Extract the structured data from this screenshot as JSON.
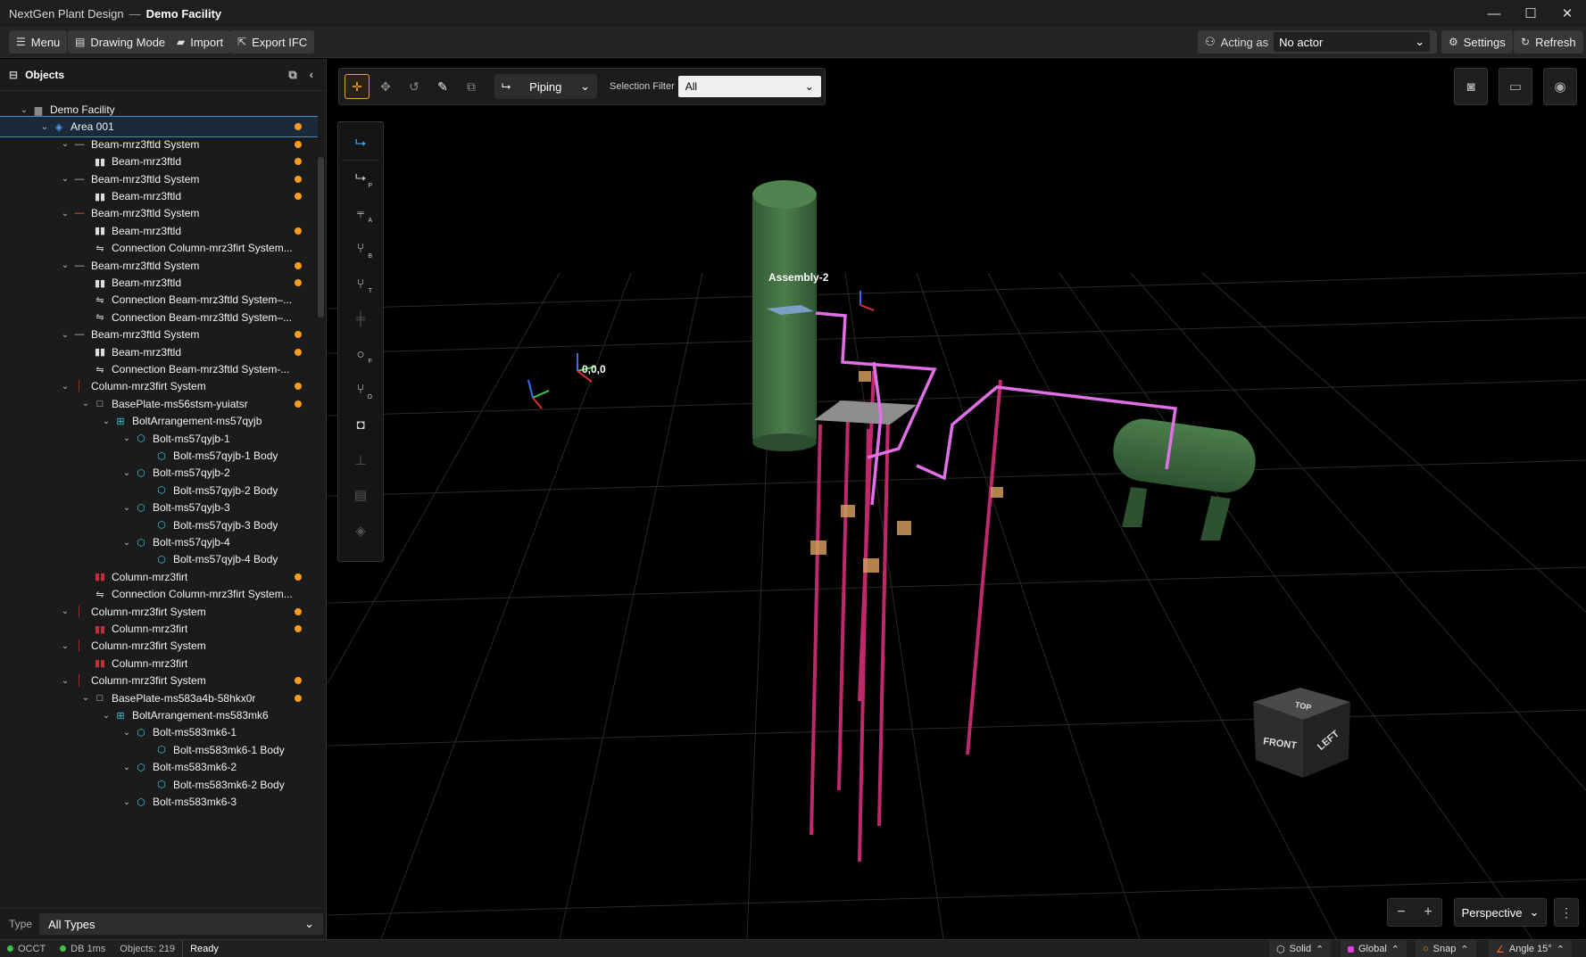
{
  "window": {
    "app_name": "NextGen Plant Design",
    "separator": "—",
    "project_name": "Demo Facility",
    "minimize": "—",
    "maximize": "☐",
    "close": "✕"
  },
  "toolbar": {
    "menu": "Menu",
    "drawing_mode": "Drawing Mode",
    "import": "Import",
    "export_ifc": "Export IFC",
    "acting_as": "Acting as",
    "actor_value": "No actor",
    "settings": "Settings",
    "refresh": "Refresh"
  },
  "objects_panel": {
    "title": "Objects",
    "type_label": "Type",
    "type_value": "All Types",
    "tree": [
      {
        "label": "Demo Facility",
        "indent": 0,
        "expanded": true,
        "icon": "building-icon",
        "dot": false
      },
      {
        "label": "Area 001",
        "indent": 1,
        "expanded": true,
        "icon": "layers-icon",
        "dot": true,
        "selected": true
      },
      {
        "label": "Beam-mrz3ftld System",
        "indent": 2,
        "expanded": true,
        "icon": "beam-system-icon",
        "dot": true
      },
      {
        "label": "Beam-mrz3ftld",
        "indent": 3,
        "icon": "beam-icon",
        "dot": true
      },
      {
        "label": "Beam-mrz3ftld System",
        "indent": 2,
        "expanded": true,
        "icon": "beam-system-icon",
        "dot": true
      },
      {
        "label": "Beam-mrz3ftld",
        "indent": 3,
        "icon": "beam-icon",
        "dot": true
      },
      {
        "label": "Beam-mrz3ftld System",
        "indent": 2,
        "expanded": true,
        "icon": "beam-system-icon-orange",
        "dot": false
      },
      {
        "label": "Beam-mrz3ftld",
        "indent": 3,
        "icon": "beam-icon",
        "dot": true
      },
      {
        "label": "Connection Column-mrz3firt System...",
        "indent": 3,
        "icon": "connection-icon",
        "dot": false
      },
      {
        "label": "Beam-mrz3ftld System",
        "indent": 2,
        "expanded": true,
        "icon": "beam-system-icon",
        "dot": true
      },
      {
        "label": "Beam-mrz3ftld",
        "indent": 3,
        "icon": "beam-icon",
        "dot": true
      },
      {
        "label": "Connection Beam-mrz3ftld System–...",
        "indent": 3,
        "icon": "connection-icon",
        "dot": false
      },
      {
        "label": "Connection Beam-mrz3ftld System–...",
        "indent": 3,
        "icon": "connection-icon",
        "dot": false
      },
      {
        "label": "Beam-mrz3ftld System",
        "indent": 2,
        "expanded": true,
        "icon": "beam-system-icon",
        "dot": true
      },
      {
        "label": "Beam-mrz3ftld",
        "indent": 3,
        "icon": "beam-icon",
        "dot": true
      },
      {
        "label": "Connection Beam-mrz3ftld System-...",
        "indent": 3,
        "icon": "connection-icon",
        "dot": false
      },
      {
        "label": "Column-mrz3firt System",
        "indent": 2,
        "expanded": true,
        "icon": "column-system-icon",
        "dot": true
      },
      {
        "label": "BasePlate-ms56stsm-yuiatsr",
        "indent": 3,
        "expanded": true,
        "icon": "plate-icon",
        "dot": true
      },
      {
        "label": "BoltArrangement-ms57qyjb",
        "indent": 4,
        "expanded": true,
        "icon": "grid-icon",
        "dot": false
      },
      {
        "label": "Bolt-ms57qyjb-1",
        "indent": 5,
        "expanded": true,
        "icon": "bolt-icon",
        "dot": false
      },
      {
        "label": "Bolt-ms57qyjb-1 Body",
        "indent": 6,
        "icon": "bolt-icon",
        "dot": false
      },
      {
        "label": "Bolt-ms57qyjb-2",
        "indent": 5,
        "expanded": true,
        "icon": "bolt-icon",
        "dot": false
      },
      {
        "label": "Bolt-ms57qyjb-2 Body",
        "indent": 6,
        "icon": "bolt-icon",
        "dot": false
      },
      {
        "label": "Bolt-ms57qyjb-3",
        "indent": 5,
        "expanded": true,
        "icon": "bolt-icon",
        "dot": false
      },
      {
        "label": "Bolt-ms57qyjb-3 Body",
        "indent": 6,
        "icon": "bolt-icon",
        "dot": false
      },
      {
        "label": "Bolt-ms57qyjb-4",
        "indent": 5,
        "expanded": true,
        "icon": "bolt-icon",
        "dot": false
      },
      {
        "label": "Bolt-ms57qyjb-4 Body",
        "indent": 6,
        "icon": "bolt-icon",
        "dot": false
      },
      {
        "label": "Column-mrz3firt",
        "indent": 3,
        "icon": "column-icon",
        "dot": true
      },
      {
        "label": "Connection Column-mrz3firt System...",
        "indent": 3,
        "icon": "connection-icon",
        "dot": false
      },
      {
        "label": "Column-mrz3firt System",
        "indent": 2,
        "expanded": true,
        "icon": "column-system-icon",
        "dot": true
      },
      {
        "label": "Column-mrz3firt",
        "indent": 3,
        "icon": "column-icon",
        "dot": true
      },
      {
        "label": "Column-mrz3firt System",
        "indent": 2,
        "expanded": true,
        "icon": "column-system-icon",
        "dot": false
      },
      {
        "label": "Column-mrz3firt",
        "indent": 3,
        "icon": "column-icon",
        "dot": false
      },
      {
        "label": "Column-mrz3firt System",
        "indent": 2,
        "expanded": true,
        "icon": "column-system-icon",
        "dot": true
      },
      {
        "label": "BasePlate-ms583a4b-58hkx0r",
        "indent": 3,
        "expanded": true,
        "icon": "plate-icon",
        "dot": true
      },
      {
        "label": "BoltArrangement-ms583mk6",
        "indent": 4,
        "expanded": true,
        "icon": "grid-icon",
        "dot": false
      },
      {
        "label": "Bolt-ms583mk6-1",
        "indent": 5,
        "expanded": true,
        "icon": "bolt-icon",
        "dot": false
      },
      {
        "label": "Bolt-ms583mk6-1 Body",
        "indent": 6,
        "icon": "bolt-icon",
        "dot": false
      },
      {
        "label": "Bolt-ms583mk6-2",
        "indent": 5,
        "expanded": true,
        "icon": "bolt-icon",
        "dot": false
      },
      {
        "label": "Bolt-ms583mk6-2 Body",
        "indent": 6,
        "icon": "bolt-icon",
        "dot": false
      },
      {
        "label": "Bolt-ms583mk6-3",
        "indent": 5,
        "expanded": true,
        "icon": "bolt-icon",
        "dot": false
      }
    ]
  },
  "viewport": {
    "mode": "Piping",
    "selection_filter_label": "Selection Filter",
    "selection_filter_value": "All",
    "assembly_label": "Assembly-2",
    "origin_label": "0,0,0",
    "cube_top": "TOP",
    "cube_front": "FRONT",
    "cube_left": "LEFT",
    "projection": "Perspective",
    "zoom_out": "−",
    "zoom_in": "+",
    "palette": [
      {
        "icon": "pipe-route-icon",
        "sub": "",
        "active": true
      },
      {
        "icon": "pipe-p-icon",
        "sub": "P"
      },
      {
        "icon": "pipe-a-icon",
        "sub": "A"
      },
      {
        "icon": "pipe-b-icon",
        "sub": "B"
      },
      {
        "icon": "pipe-t-icon",
        "sub": "T"
      },
      {
        "icon": "pipe-joint-icon",
        "sub": "",
        "dim": true
      },
      {
        "icon": "flange-icon",
        "sub": "F"
      },
      {
        "icon": "pipe-o-icon",
        "sub": "O"
      },
      {
        "icon": "nozzle-icon",
        "sub": ""
      },
      {
        "icon": "valve-icon",
        "sub": "",
        "dim": true
      },
      {
        "icon": "document-icon",
        "sub": "",
        "dim": true
      },
      {
        "icon": "cube-icon",
        "sub": "",
        "dim": true
      }
    ]
  },
  "status": {
    "engine": "OCCT",
    "db": "DB 1ms",
    "objects": "Objects: 219",
    "state": "Ready",
    "render": "Solid",
    "coords": "Global",
    "snap": "Snap",
    "angle": "Angle 15°"
  },
  "colors": {
    "accent_orange": "#ff9d1b",
    "selection_blue": "#3b8fd6",
    "pipe_magenta": "#e060e0",
    "equipment_green": "#3f6b3f"
  }
}
